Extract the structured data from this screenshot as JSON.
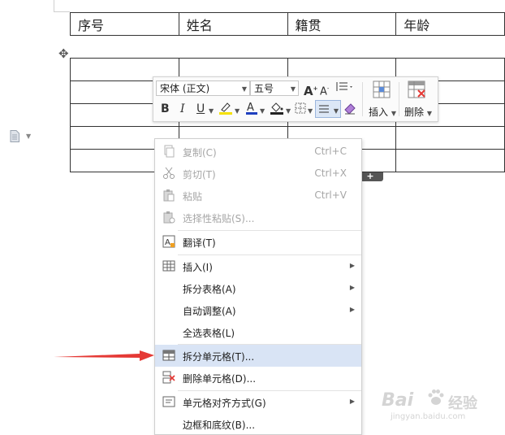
{
  "table": {
    "headers": [
      "序号",
      "姓名",
      "籍贯",
      "年龄"
    ]
  },
  "toolbar": {
    "font_name": "宋体 (正文)",
    "font_size": "五号",
    "bold": "B",
    "italic": "I",
    "underline": "U",
    "insert_label": "插入",
    "delete_label": "删除"
  },
  "context_menu": {
    "items": [
      {
        "label": "复制(C)",
        "shortcut": "Ctrl+C",
        "icon": "copy-icon",
        "disabled": true
      },
      {
        "label": "剪切(T)",
        "shortcut": "Ctrl+X",
        "icon": "scissors-icon",
        "disabled": true
      },
      {
        "label": "粘贴",
        "shortcut": "Ctrl+V",
        "icon": "paste-icon",
        "disabled": true
      },
      {
        "label": "选择性粘贴(S)...",
        "icon": "paste-special-icon",
        "disabled": true
      },
      {
        "label": "翻译(T)",
        "icon": "translate-icon"
      },
      {
        "label": "插入(I)",
        "icon": "table-insert-icon",
        "submenu": true
      },
      {
        "label": "拆分表格(A)",
        "submenu": true
      },
      {
        "label": "自动调整(A)",
        "submenu": true
      },
      {
        "label": "全选表格(L)"
      },
      {
        "label": "拆分单元格(T)...",
        "icon": "split-cells-icon",
        "highlighted": true
      },
      {
        "label": "删除单元格(D)...",
        "icon": "delete-cells-icon"
      },
      {
        "label": "单元格对齐方式(G)",
        "icon": "cell-align-icon",
        "submenu": true
      },
      {
        "label": "边框和底纹(B)..."
      }
    ]
  },
  "watermark": {
    "brand": "Bai",
    "brand2": "经验",
    "url": "jingyan.baidu.com"
  },
  "colors": {
    "highlight": "#d9e4f5",
    "arrow": "#e53935",
    "highlighter_yellow": "#f5e100",
    "font_color": "#1f3fbf"
  }
}
